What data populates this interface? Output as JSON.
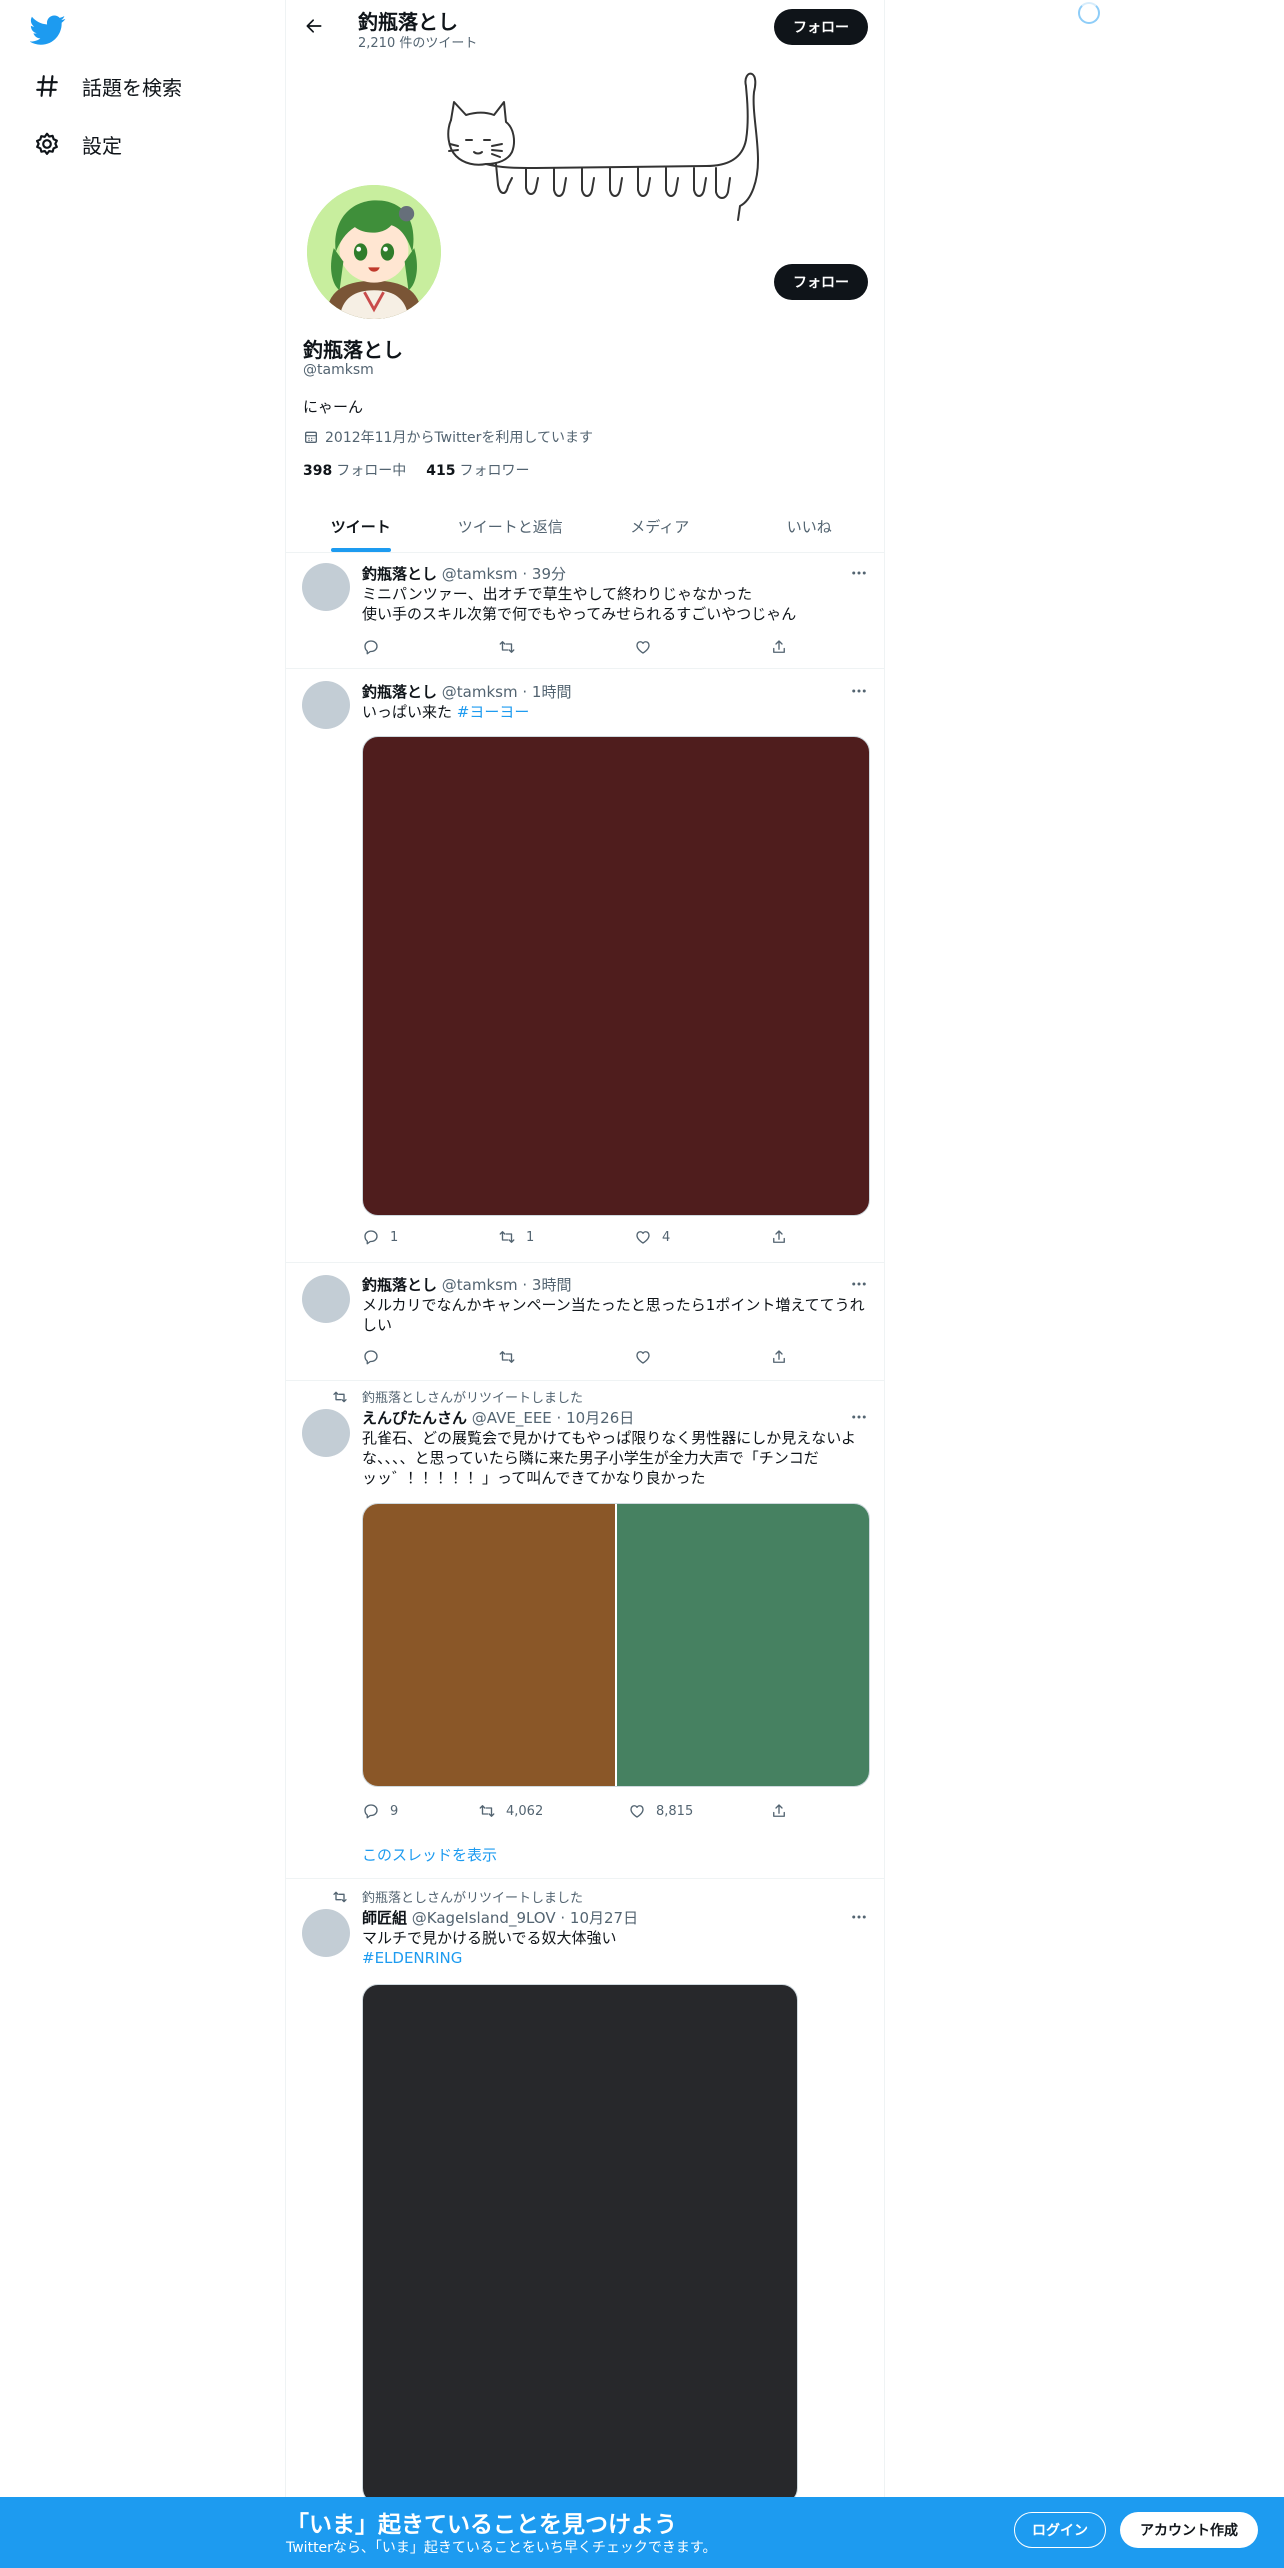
{
  "nav": {
    "explore_label": "話題を検索",
    "settings_label": "設定"
  },
  "header": {
    "name": "釣瓶落とし",
    "tweet_count": "2,210 件のツイート",
    "follow_label": "フォロー"
  },
  "profile": {
    "name": "釣瓶落とし",
    "handle": "@tamksm",
    "bio": "にゃーん",
    "joined": "2012年11月からTwitterを利用しています",
    "following_count": "398",
    "following_label": "フォロー中",
    "followers_count": "415",
    "followers_label": "フォロワー",
    "follow_label": "フォロー"
  },
  "tabs": [
    {
      "label": "ツイート"
    },
    {
      "label": "ツイートと返信"
    },
    {
      "label": "メディア"
    },
    {
      "label": "いいね"
    }
  ],
  "tweets": [
    {
      "name": "釣瓶落とし",
      "meta": "@tamksm · 39分",
      "line1": "ミニパンツァー、出オチで草生やして終わりじゃなかった",
      "line2": "使い手のスキル次第で何でもやってみせられるすごいやつじゃん",
      "replies": "",
      "retweets": "",
      "likes": ""
    },
    {
      "name": "釣瓶落とし",
      "meta": "@tamksm · 1時間",
      "text": "いっぱい来た ",
      "tag": "#ヨーヨー",
      "media_color": "#4f1d1d",
      "replies": "1",
      "retweets": "1",
      "likes": "4"
    },
    {
      "name": "釣瓶落とし",
      "meta": "@tamksm · 3時間",
      "line1": "メルカリでなんかキャンペーン当たったと思ったら1ポイント増えててうれ",
      "line2": "しい",
      "replies": "",
      "retweets": "",
      "likes": ""
    },
    {
      "retweet_label": "釣瓶落としさんがリツイートしました",
      "name": "えんぴたんさん",
      "meta": "@AVE_EEE · 10月26日",
      "line1": "孔雀石、どの展覧会で見かけてもやっぱ限りなく男性器にしか見えないよ",
      "line2": "な、、、、と思っていたら隣に来た男子小学生が全力大声で「チンコだ",
      "line3": "ッッ゛！！！！！」って叫んできてかなり良かった",
      "media_colors": [
        "#8a5728",
        "#468161"
      ],
      "replies": "9",
      "retweets": "4,062",
      "likes": "8,815",
      "thread_label": "このスレッドを表示"
    },
    {
      "retweet_label": "釣瓶落としさんがリツイートしました",
      "name": "師匠組",
      "meta": "@KageIsland_9LOV · 10月27日",
      "line1": "マルチで見かける脱いでる奴大体強い",
      "tag": "#ELDENRING",
      "media_color": "#27282b"
    }
  ],
  "bottom_bar": {
    "title": "「いま」起きていることを見つけよう",
    "subtitle": "Twitterなら、「いま」起きていることをいち早くチェックできます。",
    "login_label": "ログイン",
    "signup_label": "アカウント作成"
  },
  "colors": {
    "accent": "#1d9bf0",
    "text": "#0f1419",
    "muted": "#536471"
  }
}
